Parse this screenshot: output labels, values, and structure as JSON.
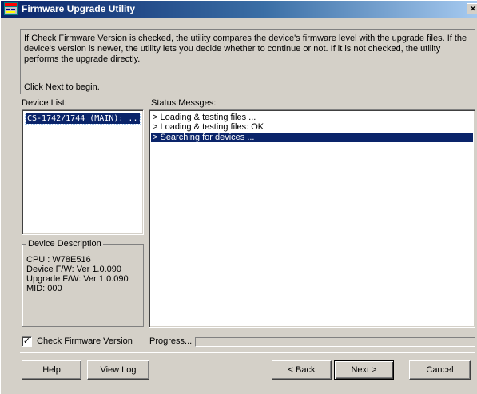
{
  "window": {
    "title": "Firmware Upgrade Utility",
    "close_glyph": "×",
    "icon": "app-window-icon"
  },
  "info": {
    "text": "If Check Firmware Version is checked, the utility compares the device's firmware level with the upgrade files. If the device's version is newer, the utility lets you decide whether to continue or not. If it is not checked, the utility performs the upgrade directly.",
    "next_hint": "Click Next to begin."
  },
  "device_list": {
    "label": "Device List:",
    "items": [
      "CS-1742/1744 (MAIN): ..."
    ]
  },
  "status": {
    "label": "Status Messges:",
    "items": [
      "> Loading & testing files ...",
      "> Loading & testing files: OK",
      "> Searching for devices ..."
    ],
    "selected_index": 2
  },
  "device_description": {
    "title": "Device Description",
    "lines": [
      "CPU : W78E516",
      "Device F/W: Ver 1.0.090",
      "Upgrade F/W: Ver 1.0.090",
      "MID: 000"
    ]
  },
  "options": {
    "check_firmware_label": "Check Firmware Version",
    "check_firmware_checked": true,
    "check_mark": "✓",
    "progress_label": "Progress...",
    "progress_fraction": 0
  },
  "buttons": {
    "help": "Help",
    "view_log": "View Log",
    "back": "< Back",
    "next": "Next >",
    "cancel": "Cancel"
  },
  "colors": {
    "title_gradient_start": "#0a246a",
    "selection": "#0a246a",
    "face": "#d4d0c8"
  }
}
